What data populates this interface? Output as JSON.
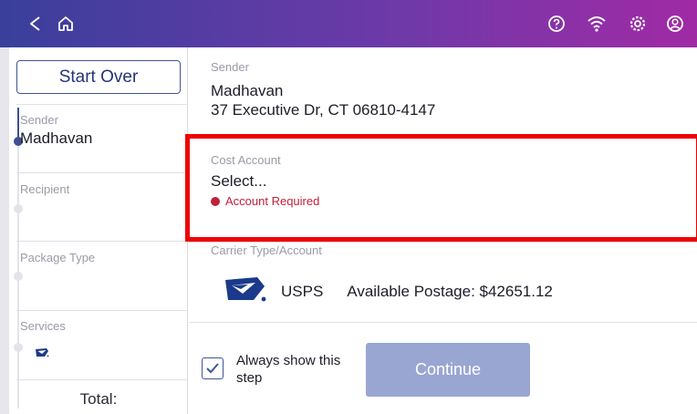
{
  "topbar": {
    "left_icons": [
      "back-icon",
      "home-icon"
    ],
    "right_icons": [
      "help-icon",
      "wifi-icon",
      "settings-icon",
      "account-icon"
    ],
    "gradient": [
      "#3a3f9c",
      "#a12aa6"
    ]
  },
  "sidebar": {
    "start_over": "Start Over",
    "steps": [
      {
        "label": "Sender",
        "value": "Madhavan"
      },
      {
        "label": "Recipient",
        "value": ""
      },
      {
        "label": "Package Type",
        "value": ""
      },
      {
        "label": "Services",
        "value": ""
      }
    ],
    "total_label": "Total:"
  },
  "main": {
    "sender": {
      "label": "Sender",
      "name": "Madhavan",
      "address": "37 Executive Dr, CT 06810-4147"
    },
    "cost_account": {
      "label": "Cost Account",
      "value": "Select...",
      "error": "Account Required"
    },
    "carrier": {
      "label": "Carrier Type/Account",
      "name": "USPS",
      "postage": "Available Postage: $42651.12"
    },
    "footer": {
      "always_show": "Always show this step",
      "always_show_checked": true,
      "continue": "Continue"
    }
  },
  "colors": {
    "highlight": "#ee0000",
    "accent": "#3f4f8f",
    "error": "#c0213a",
    "continue_disabled": "#9aa6d2"
  }
}
